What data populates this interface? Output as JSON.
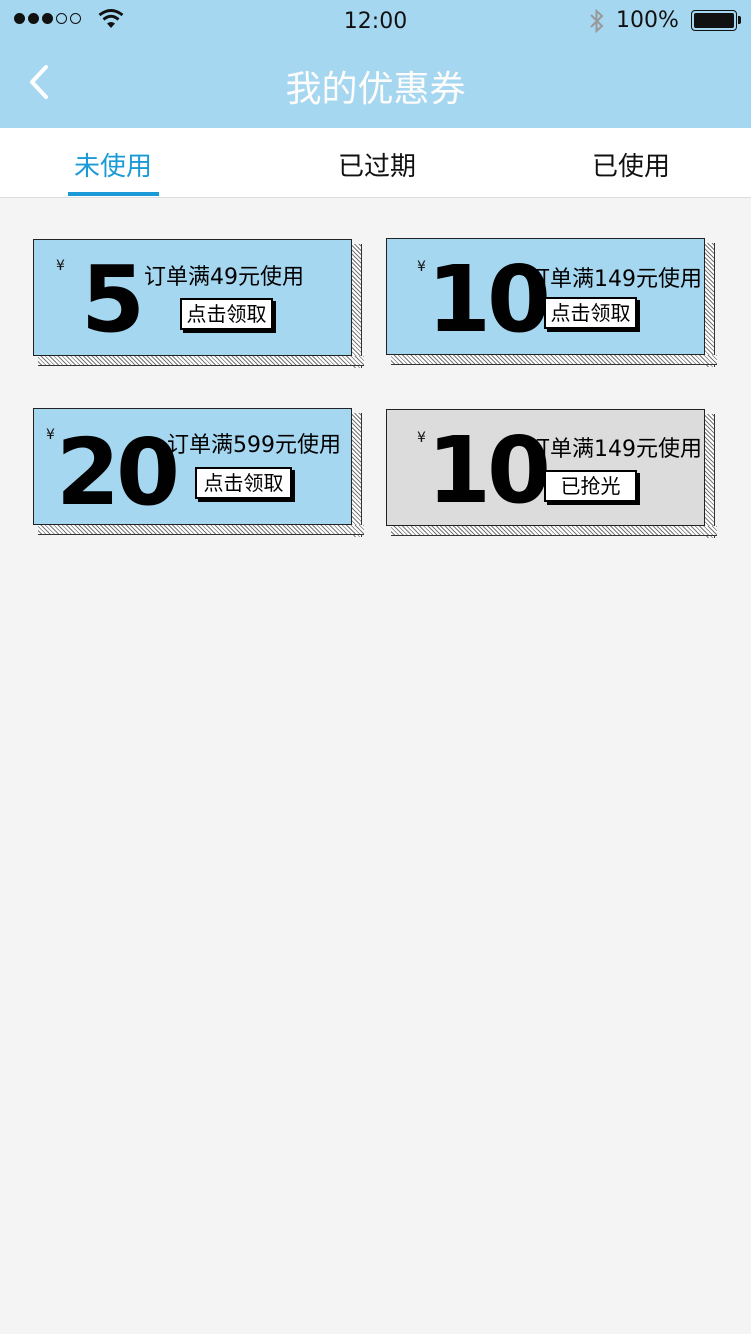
{
  "status_bar": {
    "time": "12:00",
    "battery": "100%",
    "signal_icon": "signal-dots-icon",
    "wifi_icon": "wifi-icon",
    "bluetooth_icon": "bluetooth-icon",
    "battery_icon": "battery-icon"
  },
  "header": {
    "title": "我的优惠券",
    "back_icon": "chevron-left-icon",
    "title_color": "#fffcfc",
    "background": "#a6d7f0"
  },
  "tabs": [
    {
      "label": "未使用",
      "active": true
    },
    {
      "label": "已过期",
      "active": false
    },
    {
      "label": "已使用",
      "active": false
    }
  ],
  "accent_color": "#1a9bd7",
  "coupons": [
    {
      "currency": "¥",
      "amount": "5",
      "condition": "订单满49元使用",
      "action": "点击领取",
      "state": "available"
    },
    {
      "currency": "¥",
      "amount": "10",
      "condition": "订单满149元使用",
      "action": "点击领取",
      "state": "available"
    },
    {
      "currency": "¥",
      "amount": "20",
      "condition": "订单满599元使用",
      "action": "点击领取",
      "state": "available"
    },
    {
      "currency": "¥",
      "amount": "10",
      "condition": "订单满149元使用",
      "action": "已抢光",
      "state": "sold-out"
    }
  ]
}
